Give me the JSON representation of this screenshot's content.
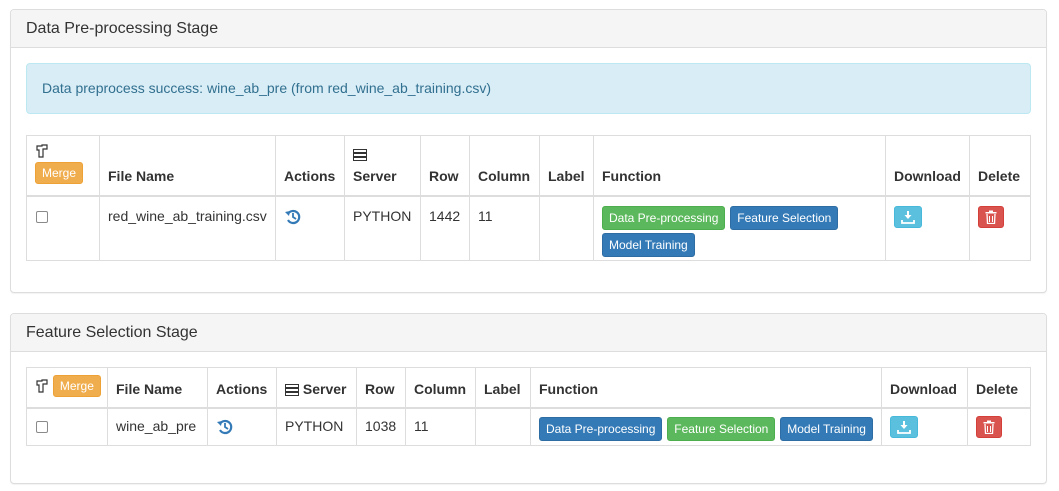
{
  "panel1": {
    "title": "Data Pre-processing Stage",
    "alert": "Data preprocess success: wine_ab_pre (from red_wine_ab_training.csv)",
    "headers": {
      "merge": "Merge",
      "file_name": "File Name",
      "actions": "Actions",
      "server": "Server",
      "row": "Row",
      "column": "Column",
      "label": "Label",
      "function": "Function",
      "download": "Download",
      "delete": "Delete"
    },
    "rows": [
      {
        "file_name": "red_wine_ab_training.csv",
        "server": "PYTHON",
        "row": "1442",
        "column": "11",
        "label": "",
        "functions": [
          "Data Pre-processing",
          "Feature Selection",
          "Model Training"
        ]
      }
    ]
  },
  "panel2": {
    "title": "Feature Selection Stage",
    "headers": {
      "merge": "Merge",
      "file_name": "File Name",
      "actions": "Actions",
      "server": "Server",
      "row": "Row",
      "column": "Column",
      "label": "Label",
      "function": "Function",
      "download": "Download",
      "delete": "Delete"
    },
    "rows": [
      {
        "file_name": "wine_ab_pre",
        "server": "PYTHON",
        "row": "1038",
        "column": "11",
        "label": "",
        "functions": [
          "Data Pre-processing",
          "Feature Selection",
          "Model Training"
        ]
      }
    ]
  },
  "icons": {
    "select": "hand-pointer-icon",
    "server": "server-icon",
    "actions": "reload-icon",
    "download": "download-icon",
    "delete": "trash-icon"
  },
  "colors": {
    "warning": "#f0ad4e",
    "success": "#5cb85c",
    "primary": "#337ab7",
    "info": "#5bc0de",
    "danger": "#d9534f",
    "alert_bg": "#d9edf7"
  }
}
